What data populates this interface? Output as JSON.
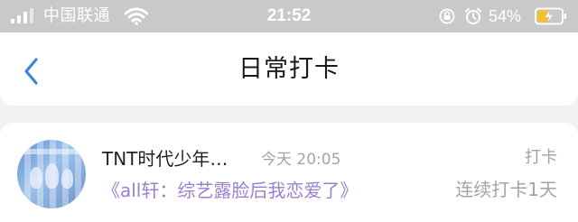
{
  "status_bar": {
    "carrier": "中国联通",
    "time": "21:52",
    "battery_percent": "54%",
    "icons": [
      "signal-icon",
      "wifi-icon",
      "orientation-lock-icon",
      "alarm-icon",
      "battery-charging-icon"
    ]
  },
  "nav": {
    "title": "日常打卡",
    "back_icon": "chevron-left-icon"
  },
  "card": {
    "group_name": "TNT时代少年…",
    "time": "今天 20:05",
    "type_label": "打卡",
    "post_title": "《all轩：综艺露脸后我恋爱了》",
    "streak": "连续打卡1天"
  },
  "colors": {
    "status_bar_bg": "#c9c9cb",
    "accent_blue": "#3e86d6",
    "post_title_purple": "#9b80cf",
    "secondary_gray": "#a3a3a8",
    "battery_yellow": "#f2c22e"
  }
}
